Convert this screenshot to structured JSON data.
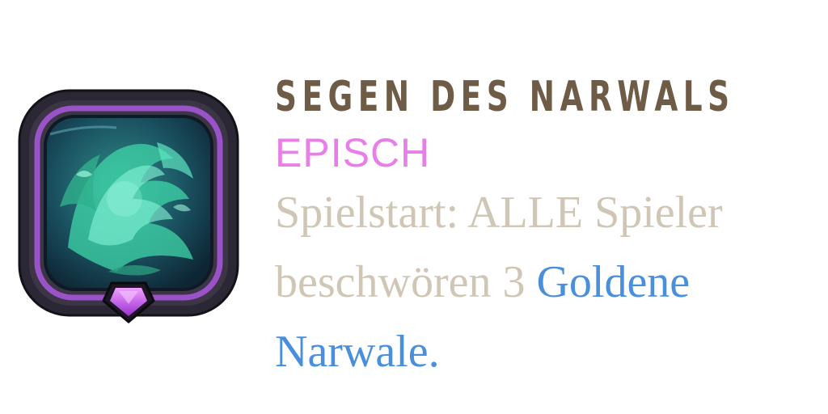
{
  "title": "SEGEN DES NARWALS",
  "rarity": "EPISCH",
  "description": {
    "lead": "Spielstart: ALLE Spieler beschwören 3 ",
    "keyword": "Goldene Narwale",
    "tail": "."
  },
  "icon": "narwhal-blessing-icon",
  "colors": {
    "title": "#6f5c47",
    "rarity": "#e87ee8",
    "description": "#d0c6b6",
    "keyword": "#4a8fdc",
    "frame_dark": "#2b2734",
    "frame_purple": "#9a52c8",
    "frame_gold": "#b59f78",
    "gem": "#c14fe6"
  }
}
